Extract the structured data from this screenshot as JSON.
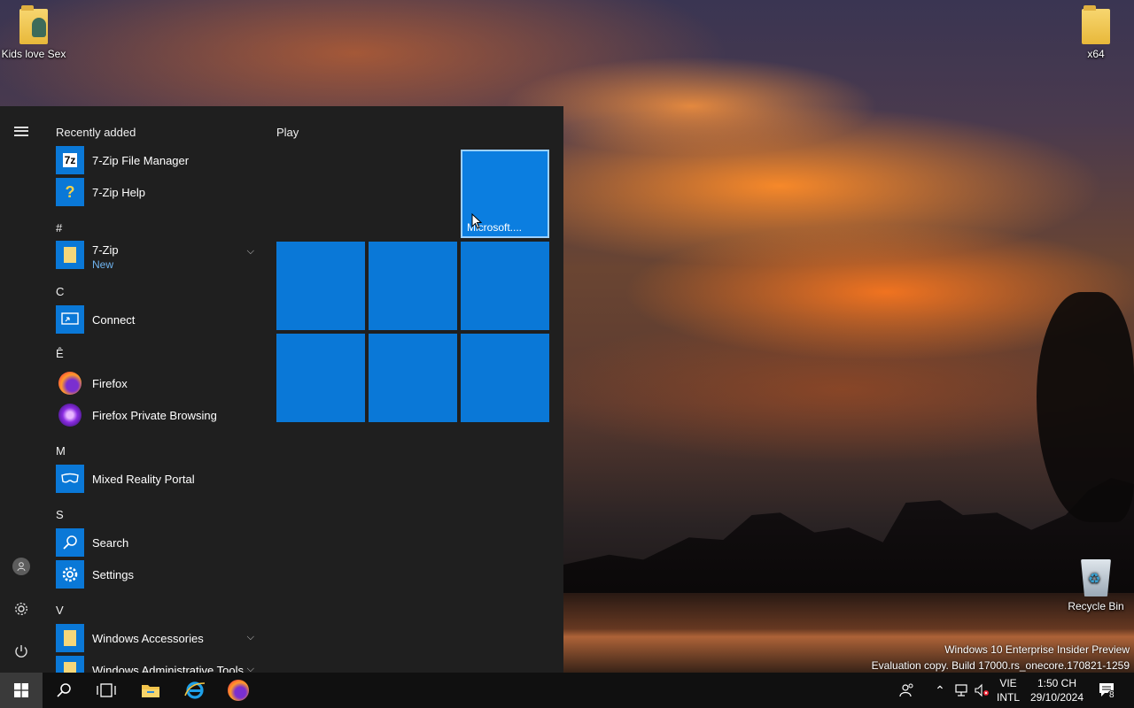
{
  "desktop": {
    "icons": [
      {
        "label": "Kids love Sex",
        "icon": "folder-user-icon"
      },
      {
        "label": "x64",
        "icon": "folder-icon"
      },
      {
        "label": "Recycle Bin",
        "icon": "recycle-bin-icon"
      }
    ],
    "watermark": {
      "line1": "Windows 10 Enterprise Insider Preview",
      "line2": "Evaluation copy. Build 17000.rs_onecore.170821-1259"
    }
  },
  "start_menu": {
    "rail": {
      "menu_icon": "hamburger-icon",
      "user_icon": "user-icon",
      "settings_icon": "gear-icon",
      "power_icon": "power-icon"
    },
    "recently_added_header": "Recently added",
    "recently_added": [
      {
        "label": "7-Zip File Manager",
        "icon": "7zip-icon",
        "glyph": "7z"
      },
      {
        "label": "7-Zip Help",
        "icon": "help-icon",
        "glyph": "?"
      }
    ],
    "groups": [
      {
        "letter": "#",
        "items": [
          {
            "label": "7-Zip",
            "sub": "New",
            "icon": "folder-icon",
            "expandable": true
          }
        ]
      },
      {
        "letter": "C",
        "items": [
          {
            "label": "Connect",
            "icon": "connect-icon"
          }
        ]
      },
      {
        "letter": "Ê",
        "items": [
          {
            "label": "Firefox",
            "icon": "firefox-icon"
          },
          {
            "label": "Firefox Private Browsing",
            "icon": "firefox-private-icon"
          }
        ]
      },
      {
        "letter": "M",
        "items": [
          {
            "label": "Mixed Reality Portal",
            "icon": "mixed-reality-icon"
          }
        ]
      },
      {
        "letter": "S",
        "items": [
          {
            "label": "Search",
            "icon": "search-icon"
          },
          {
            "label": "Settings",
            "icon": "gear-icon"
          }
        ]
      },
      {
        "letter": "V",
        "items": [
          {
            "label": "Windows Accessories",
            "icon": "folder-icon",
            "expandable": true
          },
          {
            "label": "Windows Administrative Tools",
            "icon": "folder-icon",
            "expandable": true
          }
        ]
      }
    ],
    "tiles_header": "Play",
    "focused_tile_label": "Microsoft....",
    "tile_color": "#0a78d7"
  },
  "taskbar": {
    "buttons": [
      "start-icon",
      "search-icon",
      "task-view-icon",
      "file-explorer-icon",
      "internet-explorer-icon",
      "firefox-icon"
    ],
    "tray": {
      "people_icon": "people-icon",
      "overflow_icon": "chevron-up-icon",
      "network_icon": "network-icon",
      "volume_icon": "volume-muted-icon",
      "language_line1": "VIE",
      "language_line2": "INTL",
      "time": "1:50 CH",
      "date": "29/10/2024",
      "notifications_count": "8"
    }
  }
}
